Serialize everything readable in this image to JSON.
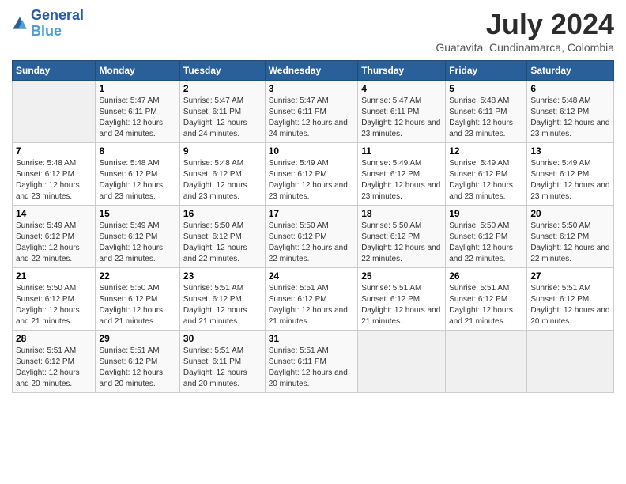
{
  "header": {
    "logo_line1": "General",
    "logo_line2": "Blue",
    "month": "July 2024",
    "location": "Guatavita, Cundinamarca, Colombia"
  },
  "weekdays": [
    "Sunday",
    "Monday",
    "Tuesday",
    "Wednesday",
    "Thursday",
    "Friday",
    "Saturday"
  ],
  "weeks": [
    [
      {
        "day": "",
        "sunrise": "",
        "sunset": "",
        "daylight": ""
      },
      {
        "day": "1",
        "sunrise": "Sunrise: 5:47 AM",
        "sunset": "Sunset: 6:11 PM",
        "daylight": "Daylight: 12 hours and 24 minutes."
      },
      {
        "day": "2",
        "sunrise": "Sunrise: 5:47 AM",
        "sunset": "Sunset: 6:11 PM",
        "daylight": "Daylight: 12 hours and 24 minutes."
      },
      {
        "day": "3",
        "sunrise": "Sunrise: 5:47 AM",
        "sunset": "Sunset: 6:11 PM",
        "daylight": "Daylight: 12 hours and 24 minutes."
      },
      {
        "day": "4",
        "sunrise": "Sunrise: 5:47 AM",
        "sunset": "Sunset: 6:11 PM",
        "daylight": "Daylight: 12 hours and 23 minutes."
      },
      {
        "day": "5",
        "sunrise": "Sunrise: 5:48 AM",
        "sunset": "Sunset: 6:11 PM",
        "daylight": "Daylight: 12 hours and 23 minutes."
      },
      {
        "day": "6",
        "sunrise": "Sunrise: 5:48 AM",
        "sunset": "Sunset: 6:12 PM",
        "daylight": "Daylight: 12 hours and 23 minutes."
      }
    ],
    [
      {
        "day": "7",
        "sunrise": "Sunrise: 5:48 AM",
        "sunset": "Sunset: 6:12 PM",
        "daylight": "Daylight: 12 hours and 23 minutes."
      },
      {
        "day": "8",
        "sunrise": "Sunrise: 5:48 AM",
        "sunset": "Sunset: 6:12 PM",
        "daylight": "Daylight: 12 hours and 23 minutes."
      },
      {
        "day": "9",
        "sunrise": "Sunrise: 5:48 AM",
        "sunset": "Sunset: 6:12 PM",
        "daylight": "Daylight: 12 hours and 23 minutes."
      },
      {
        "day": "10",
        "sunrise": "Sunrise: 5:49 AM",
        "sunset": "Sunset: 6:12 PM",
        "daylight": "Daylight: 12 hours and 23 minutes."
      },
      {
        "day": "11",
        "sunrise": "Sunrise: 5:49 AM",
        "sunset": "Sunset: 6:12 PM",
        "daylight": "Daylight: 12 hours and 23 minutes."
      },
      {
        "day": "12",
        "sunrise": "Sunrise: 5:49 AM",
        "sunset": "Sunset: 6:12 PM",
        "daylight": "Daylight: 12 hours and 23 minutes."
      },
      {
        "day": "13",
        "sunrise": "Sunrise: 5:49 AM",
        "sunset": "Sunset: 6:12 PM",
        "daylight": "Daylight: 12 hours and 23 minutes."
      }
    ],
    [
      {
        "day": "14",
        "sunrise": "Sunrise: 5:49 AM",
        "sunset": "Sunset: 6:12 PM",
        "daylight": "Daylight: 12 hours and 22 minutes."
      },
      {
        "day": "15",
        "sunrise": "Sunrise: 5:49 AM",
        "sunset": "Sunset: 6:12 PM",
        "daylight": "Daylight: 12 hours and 22 minutes."
      },
      {
        "day": "16",
        "sunrise": "Sunrise: 5:50 AM",
        "sunset": "Sunset: 6:12 PM",
        "daylight": "Daylight: 12 hours and 22 minutes."
      },
      {
        "day": "17",
        "sunrise": "Sunrise: 5:50 AM",
        "sunset": "Sunset: 6:12 PM",
        "daylight": "Daylight: 12 hours and 22 minutes."
      },
      {
        "day": "18",
        "sunrise": "Sunrise: 5:50 AM",
        "sunset": "Sunset: 6:12 PM",
        "daylight": "Daylight: 12 hours and 22 minutes."
      },
      {
        "day": "19",
        "sunrise": "Sunrise: 5:50 AM",
        "sunset": "Sunset: 6:12 PM",
        "daylight": "Daylight: 12 hours and 22 minutes."
      },
      {
        "day": "20",
        "sunrise": "Sunrise: 5:50 AM",
        "sunset": "Sunset: 6:12 PM",
        "daylight": "Daylight: 12 hours and 22 minutes."
      }
    ],
    [
      {
        "day": "21",
        "sunrise": "Sunrise: 5:50 AM",
        "sunset": "Sunset: 6:12 PM",
        "daylight": "Daylight: 12 hours and 21 minutes."
      },
      {
        "day": "22",
        "sunrise": "Sunrise: 5:50 AM",
        "sunset": "Sunset: 6:12 PM",
        "daylight": "Daylight: 12 hours and 21 minutes."
      },
      {
        "day": "23",
        "sunrise": "Sunrise: 5:51 AM",
        "sunset": "Sunset: 6:12 PM",
        "daylight": "Daylight: 12 hours and 21 minutes."
      },
      {
        "day": "24",
        "sunrise": "Sunrise: 5:51 AM",
        "sunset": "Sunset: 6:12 PM",
        "daylight": "Daylight: 12 hours and 21 minutes."
      },
      {
        "day": "25",
        "sunrise": "Sunrise: 5:51 AM",
        "sunset": "Sunset: 6:12 PM",
        "daylight": "Daylight: 12 hours and 21 minutes."
      },
      {
        "day": "26",
        "sunrise": "Sunrise: 5:51 AM",
        "sunset": "Sunset: 6:12 PM",
        "daylight": "Daylight: 12 hours and 21 minutes."
      },
      {
        "day": "27",
        "sunrise": "Sunrise: 5:51 AM",
        "sunset": "Sunset: 6:12 PM",
        "daylight": "Daylight: 12 hours and 20 minutes."
      }
    ],
    [
      {
        "day": "28",
        "sunrise": "Sunrise: 5:51 AM",
        "sunset": "Sunset: 6:12 PM",
        "daylight": "Daylight: 12 hours and 20 minutes."
      },
      {
        "day": "29",
        "sunrise": "Sunrise: 5:51 AM",
        "sunset": "Sunset: 6:12 PM",
        "daylight": "Daylight: 12 hours and 20 minutes."
      },
      {
        "day": "30",
        "sunrise": "Sunrise: 5:51 AM",
        "sunset": "Sunset: 6:11 PM",
        "daylight": "Daylight: 12 hours and 20 minutes."
      },
      {
        "day": "31",
        "sunrise": "Sunrise: 5:51 AM",
        "sunset": "Sunset: 6:11 PM",
        "daylight": "Daylight: 12 hours and 20 minutes."
      },
      {
        "day": "",
        "sunrise": "",
        "sunset": "",
        "daylight": ""
      },
      {
        "day": "",
        "sunrise": "",
        "sunset": "",
        "daylight": ""
      },
      {
        "day": "",
        "sunrise": "",
        "sunset": "",
        "daylight": ""
      }
    ]
  ]
}
